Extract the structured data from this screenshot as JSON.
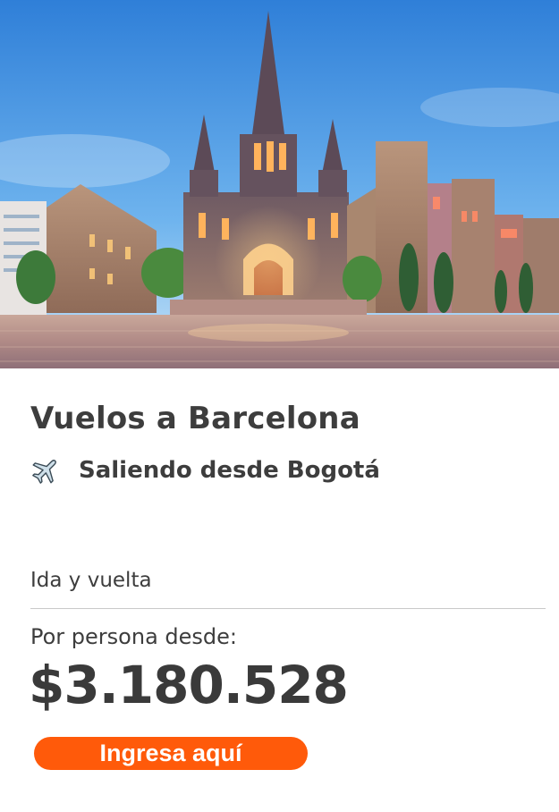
{
  "hero": {
    "image_name": "barcelona-cathedral-photo"
  },
  "offer": {
    "title": "Vuelos a Barcelona",
    "route_icon": "airplane-icon",
    "route_text": "Saliendo desde Bogotá",
    "trip_type": "Ida y vuelta",
    "price_label": "Por persona desde:",
    "price": "$3.180.528"
  },
  "cta": {
    "label": "Ingresa aquí",
    "color": "#ff5a0a"
  },
  "colors": {
    "text": "#3d3d3d",
    "divider": "#c9c9c9",
    "sky": "#3d8fe0"
  }
}
